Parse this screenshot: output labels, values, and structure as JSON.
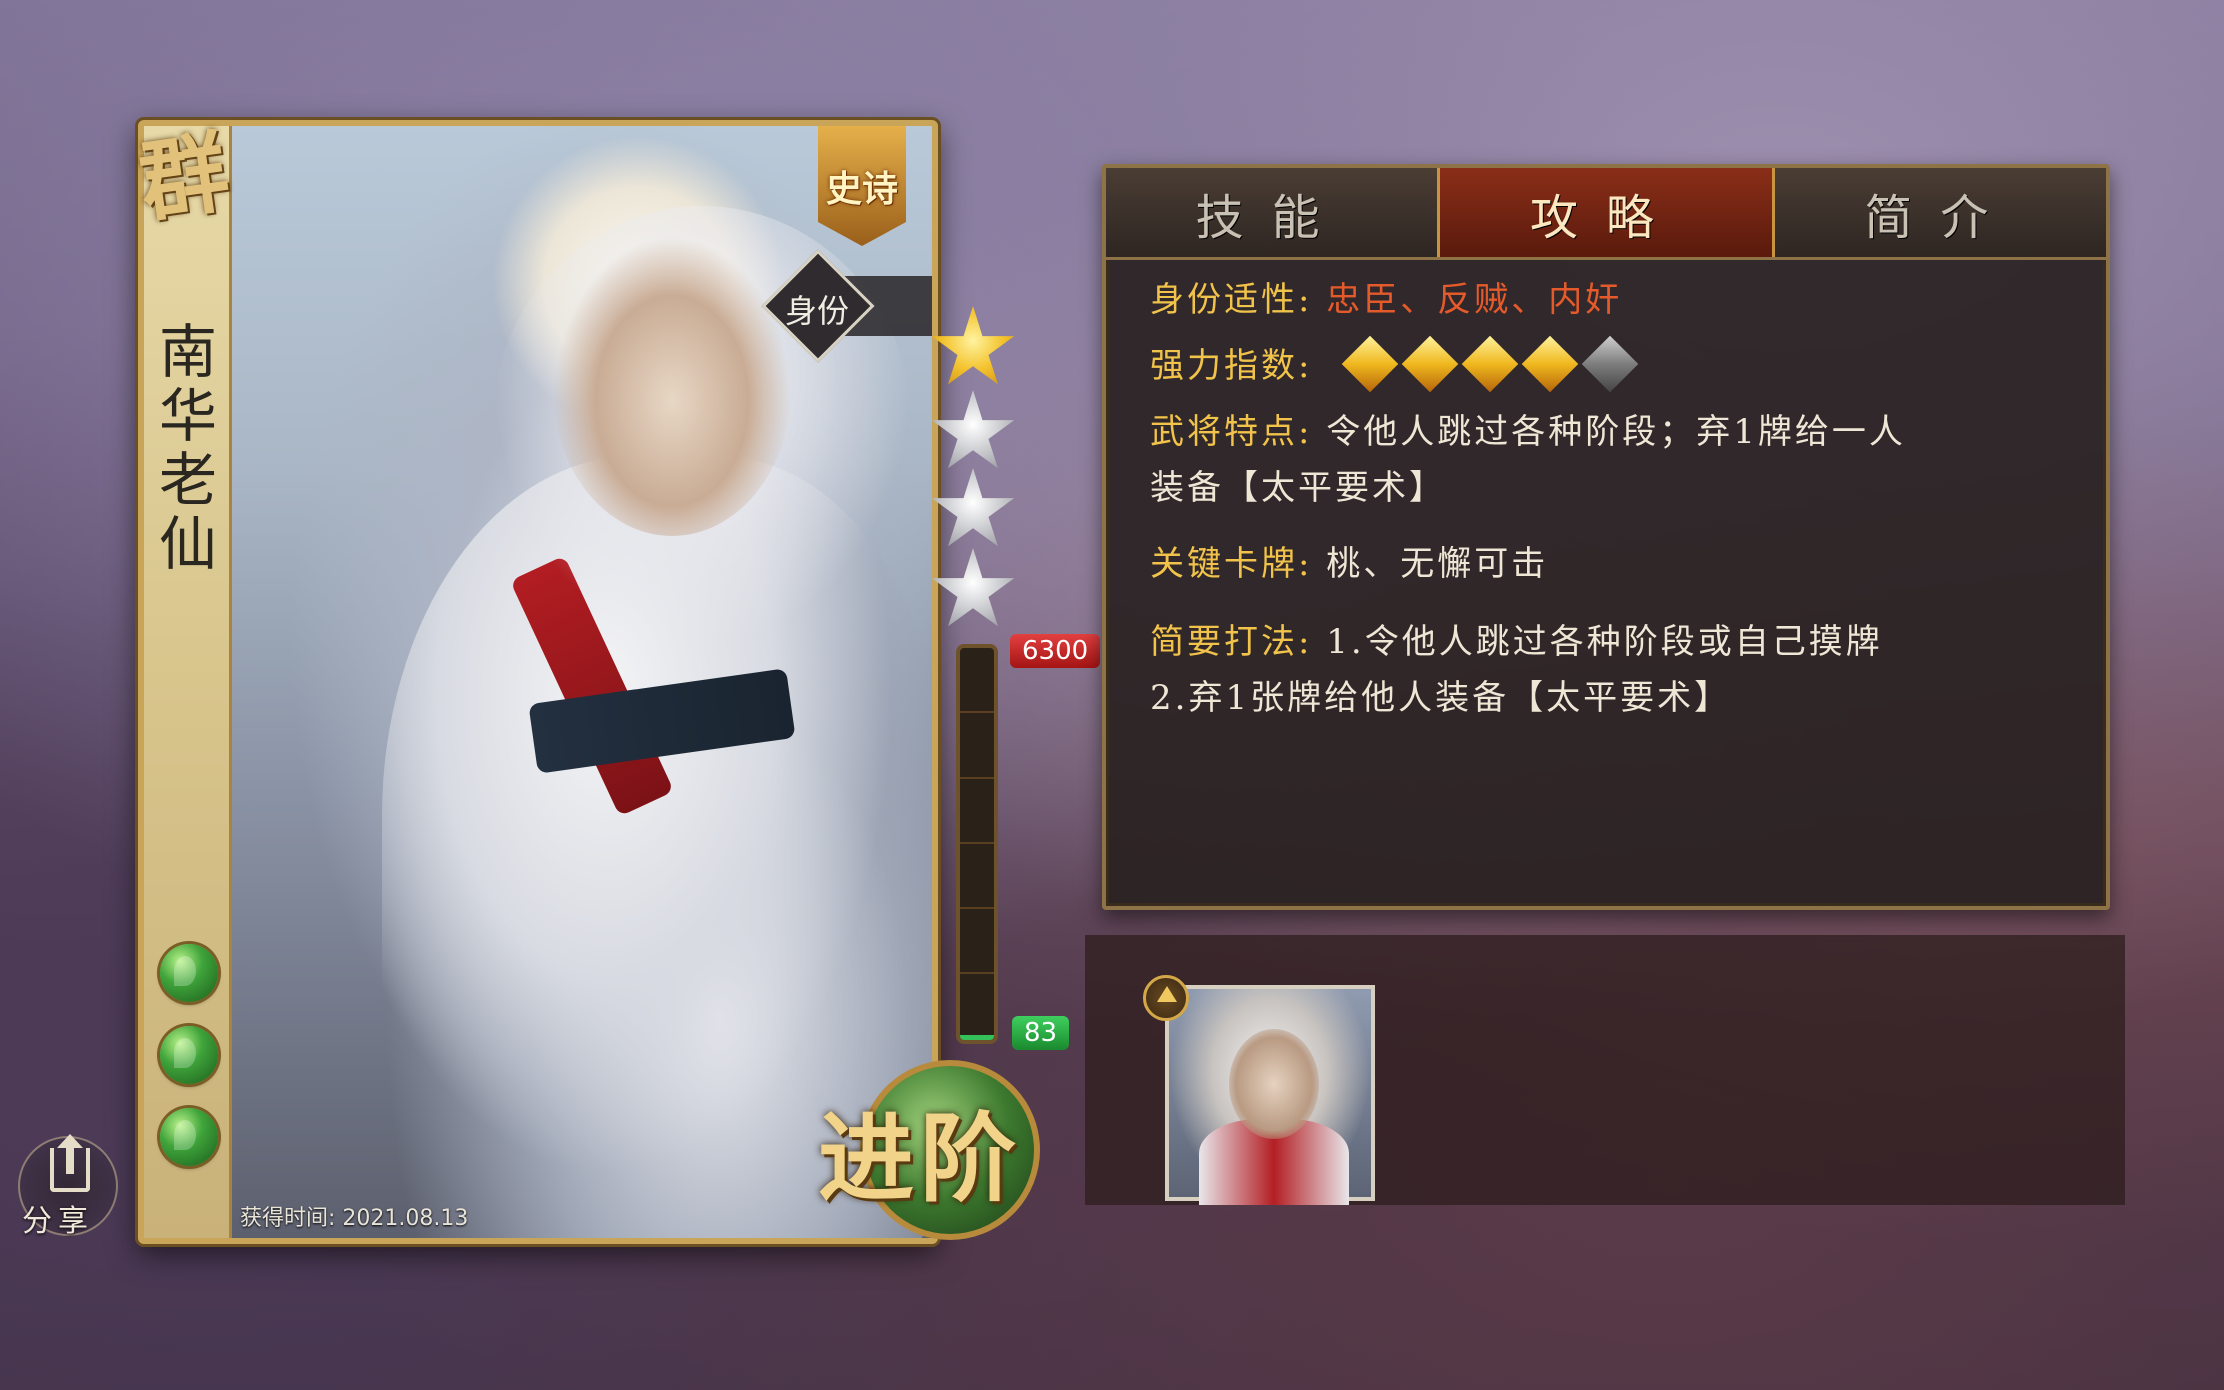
{
  "hero": {
    "faction": "群",
    "name": "南华老仙",
    "rarity": "史诗",
    "identity_label": "身份",
    "acquired": "获得时间: 2021.08.13",
    "gems": 3
  },
  "progress": {
    "stars_total": 4,
    "stars_filled": 1,
    "target_value": "6300",
    "current_value": "83",
    "fill_fraction": 0.0132
  },
  "buttons": {
    "advance": "进阶",
    "share": "分享"
  },
  "tabs": [
    {
      "label": "技能",
      "active": false
    },
    {
      "label": "攻略",
      "active": true
    },
    {
      "label": "简介",
      "active": false
    }
  ],
  "guide": {
    "identity_label": "身份适性:",
    "identity_value": "忠臣、反贼、内奸",
    "power_label": "强力指数:",
    "power_rating": 4,
    "power_max": 5,
    "traits_label": "武将特点:",
    "traits_value_1": "令他人跳过各种阶段；弃1牌给一人",
    "traits_value_2": "装备【太平要术】",
    "key_cards_label": "关键卡牌:",
    "key_cards_value": "桃、无懈可击",
    "strategy_label": "简要打法:",
    "strategy_value_1": "1.令他人跳过各种阶段或自己摸牌",
    "strategy_value_2": "2.弃1张牌给他人装备【太平要术】"
  },
  "colors": {
    "accent_gold": "#f1c34a",
    "identity_red": "#e55a2a",
    "active_tab": "#8a2e18"
  }
}
